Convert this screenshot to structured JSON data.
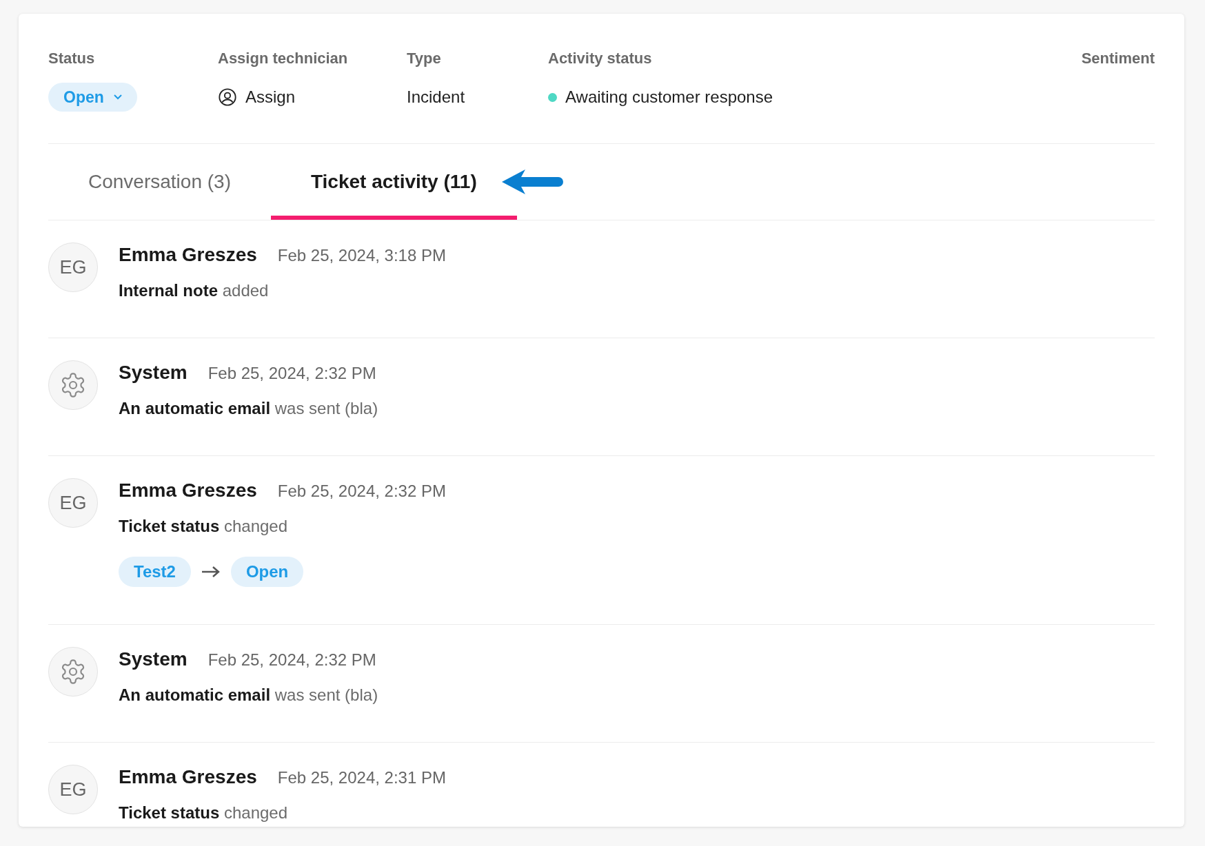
{
  "header": {
    "fields": [
      {
        "kind": "status",
        "label": "Status",
        "value": "Open"
      },
      {
        "kind": "assign",
        "label": "Assign technician",
        "value": "Assign"
      },
      {
        "kind": "text",
        "label": "Type",
        "value": "Incident"
      },
      {
        "kind": "activity",
        "label": "Activity status",
        "value": "Awaiting customer response",
        "color": "#4fd8c4"
      },
      {
        "kind": "empty",
        "label": "Sentiment"
      }
    ]
  },
  "tabs": [
    {
      "label": "Conversation (3)",
      "selected": false
    },
    {
      "label": "Ticket activity (11)",
      "selected": true
    }
  ],
  "activity": [
    {
      "kind": "initials",
      "initials": "EG",
      "author": "Emma Greszes",
      "time": "Feb 25, 2024, 3:18 PM",
      "text": "**Internal note** added"
    },
    {
      "kind": "system",
      "author": "System",
      "time": "Feb 25, 2024, 2:32 PM",
      "text": "**An automatic email** was sent (bla)"
    },
    {
      "kind": "initials",
      "initials": "EG",
      "author": "Emma Greszes",
      "time": "Feb 25, 2024, 2:32 PM",
      "text": "**Ticket status** changed",
      "change": {
        "from": "Test2",
        "to": "Open"
      }
    },
    {
      "kind": "system",
      "author": "System",
      "time": "Feb 25, 2024, 2:32 PM",
      "text": "**An automatic email** was sent (bla)"
    },
    {
      "kind": "initials",
      "initials": "EG",
      "author": "Emma Greszes",
      "time": "Feb 25, 2024, 2:31 PM",
      "text": "**Ticket status** changed"
    }
  ]
}
